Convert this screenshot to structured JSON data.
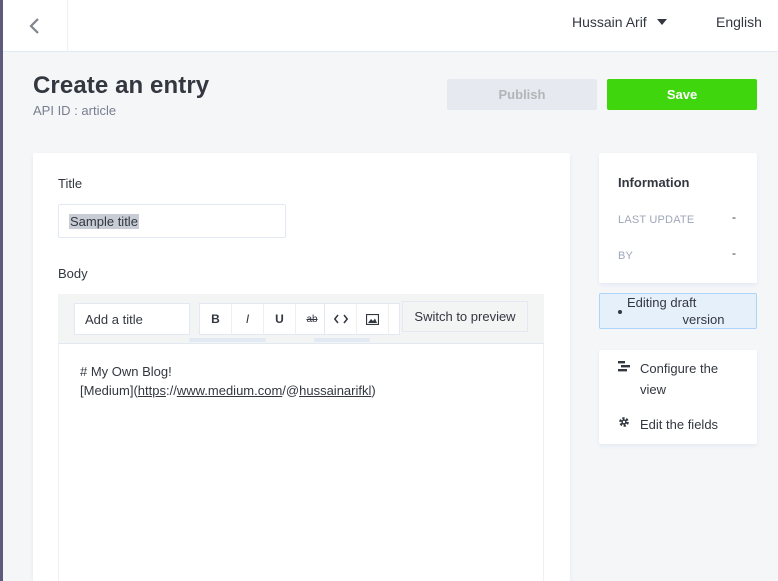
{
  "header": {
    "user_name": "Hussain Arif",
    "language": "English"
  },
  "page": {
    "title": "Create an entry",
    "subtitle": "API ID : article"
  },
  "actions": {
    "publish_label": "Publish",
    "save_label": "Save"
  },
  "form": {
    "title_label": "Title",
    "title_value": "Sample title",
    "body_label": "Body",
    "toolbar": {
      "heading_select": "Add a title",
      "bold": "B",
      "italic": "I",
      "underline": "U",
      "strikethrough": "ab",
      "switch_preview": "Switch to preview"
    },
    "body_lines": {
      "line1": "# My Own Blog!",
      "line2_prefix": "[Medium](",
      "link_https": "https",
      "link_sep1": "://",
      "link_host": "www.medium.com",
      "link_sep2": "/@",
      "link_user": "hussainarifkl",
      "line2_suffix": ")"
    }
  },
  "info": {
    "title": "Information",
    "last_update_label": "LAST UPDATE",
    "last_update_value": "-",
    "by_label": "BY",
    "by_value": "-"
  },
  "draft": {
    "line1": "Editing draft",
    "line2": "version"
  },
  "side_actions": {
    "configure_view": "Configure the view",
    "edit_fields": "Edit the fields"
  },
  "colors": {
    "save": "#3fd60e",
    "publish_bg": "#e6e9ef",
    "draft_bg": "#e6f0fb",
    "draft_border": "#aed4fb"
  },
  "icons": {
    "back": "chevron-left-icon",
    "user_caret": "caret-down-icon",
    "code": "code-icon",
    "image": "image-icon",
    "configure": "layout-icon",
    "edit_fields": "gear-icon"
  }
}
